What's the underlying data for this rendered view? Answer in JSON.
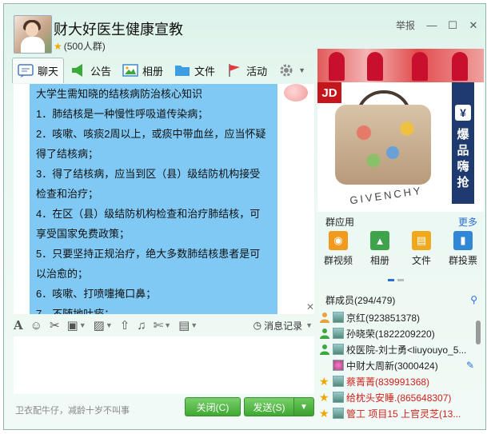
{
  "window": {
    "title": "财大好医生健康宣教",
    "member_count": "(500人群)",
    "report_label": "举报",
    "minimize_glyph": "—",
    "maximize_glyph": "☐",
    "close_glyph": "✕"
  },
  "tabs": [
    {
      "label": "聊天",
      "icon": "chat-icon"
    },
    {
      "label": "公告",
      "icon": "announcement-icon"
    },
    {
      "label": "相册",
      "icon": "album-icon"
    },
    {
      "label": "文件",
      "icon": "folder-icon"
    },
    {
      "label": "活动",
      "icon": "flag-icon"
    }
  ],
  "message": {
    "lines": [
      "大学生需知晓的结核病防治核心知识",
      "1．肺结核是一种慢性呼吸道传染病；",
      "2．咳嗽、咳痰2周以上，或痰中带血丝，应当怀疑",
      "得了结核病；",
      "3．得了结核病，应当到区（县）级结防机构接受",
      "检查和治疗；",
      "4．在区（县）级结防机构检查和治疗肺结核，可",
      "享受国家免费政策；",
      "5．只要坚持正规治疗，绝大多数肺结核患者是可",
      "以治愈的；",
      "6．咳嗽、打喷嚏掩口鼻；",
      "7．不随地吐痰；"
    ]
  },
  "toolbar": {
    "icons": [
      "font-icon",
      "emoji-icon",
      "vibrate-icon",
      "screenshot-icon",
      "image-icon",
      "upload-icon",
      "music-icon",
      "scissors-icon",
      "more-icon"
    ],
    "record_label": "消息记录"
  },
  "footer": {
    "signature": "卫衣配牛仔，减龄十岁不叫事",
    "close_label": "关闭(C)",
    "send_label": "发送(S)"
  },
  "ad": {
    "jd_label": "JD",
    "brand": "GIVENCHY",
    "vertical_text": "爆品嗨抢",
    "yen": "¥"
  },
  "group_apps": {
    "header": "群应用",
    "more": "更多",
    "items": [
      {
        "label": "群视频",
        "color": "#f29a1e",
        "glyph": "◉"
      },
      {
        "label": "相册",
        "color": "#3ea34a",
        "glyph": "▲"
      },
      {
        "label": "文件",
        "color": "#f0a81c",
        "glyph": "▤"
      },
      {
        "label": "群投票",
        "color": "#2f87d6",
        "glyph": "▮"
      }
    ]
  },
  "members": {
    "header": "群成员(294/479)",
    "list": [
      {
        "name": "京红(923851378)",
        "role": "owner",
        "highlight": false
      },
      {
        "name": "孙晓荣(1822209220)",
        "role": "admin",
        "highlight": false
      },
      {
        "name": "校医院-刘士勇<liuyouyo_5...",
        "role": "admin",
        "highlight": false
      },
      {
        "name": "中财大周新(3000424)",
        "role": "member",
        "highlight": false
      },
      {
        "name": "蔡菁菁(839991368)",
        "role": "star",
        "highlight": true
      },
      {
        "name": "给枕头安睡.(865648307)",
        "role": "star",
        "highlight": true
      },
      {
        "name": "管工 项目15  上官灵芝(13...",
        "role": "star",
        "highlight": true
      }
    ]
  }
}
